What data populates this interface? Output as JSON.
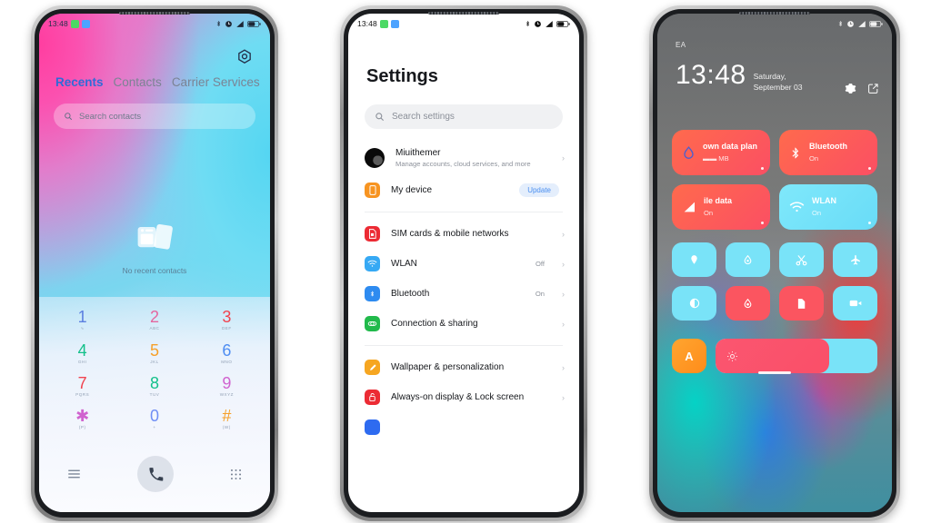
{
  "phone1": {
    "name": "dialer-screen",
    "statusbar": {
      "time": "13:48",
      "badges": [
        "green-call-badge",
        "blue-app-badge"
      ],
      "icons": [
        "bluetooth-icon",
        "alarm-icon",
        "signal-icon",
        "battery-icon"
      ]
    },
    "gear_icon": "gear-icon",
    "tabs": [
      {
        "label": "Recents",
        "active": true
      },
      {
        "label": "Contacts",
        "active": false
      },
      {
        "label": "Carrier Services",
        "active": false
      }
    ],
    "search": {
      "placeholder": "Search contacts",
      "icon": "search-icon"
    },
    "empty_state": {
      "icon": "no-contacts-icon",
      "text": "No recent contacts"
    },
    "keypad": [
      {
        "num": "1",
        "sub": "∿"
      },
      {
        "num": "2",
        "sub": "ABC"
      },
      {
        "num": "3",
        "sub": "DEF"
      },
      {
        "num": "4",
        "sub": "GHI"
      },
      {
        "num": "5",
        "sub": "JKL"
      },
      {
        "num": "6",
        "sub": "MNO"
      },
      {
        "num": "7",
        "sub": "PQRS"
      },
      {
        "num": "8",
        "sub": "TUV"
      },
      {
        "num": "9",
        "sub": "WXYZ"
      },
      {
        "num": "✱",
        "sub": "(P)"
      },
      {
        "num": "0",
        "sub": "+"
      },
      {
        "num": "#",
        "sub": "(W)"
      }
    ],
    "keypad_colors": [
      "#5b7fe0",
      "#e4679f",
      "#f0434f",
      "#13c08a",
      "#f6a02a",
      "#4e8df2",
      "#f0434f",
      "#13c08a",
      "#d063cf",
      "#d063cf",
      "#6f8ef5",
      "#f6a02a"
    ],
    "bottom": {
      "menu_icon": "menu-icon",
      "call_icon": "call-icon",
      "keypad_icon": "keypad-icon"
    }
  },
  "phone2": {
    "name": "settings-screen",
    "statusbar": {
      "time": "13:48",
      "badges": [
        "green-call-badge",
        "blue-app-badge"
      ],
      "icons": [
        "bluetooth-icon",
        "alarm-icon",
        "signal-icon",
        "battery-icon"
      ]
    },
    "title": "Settings",
    "search": {
      "placeholder": "Search settings",
      "icon": "search-icon"
    },
    "account": {
      "name": "Miuithemer",
      "subtitle": "Manage accounts, cloud services, and more",
      "avatar": "avatar"
    },
    "device": {
      "label": "My device",
      "badge": "Update",
      "icon": "phone-icon",
      "color": "#f79421"
    },
    "items": [
      {
        "label": "SIM cards & mobile networks",
        "value": "",
        "icon": "sim-icon",
        "color": "#ec2b34"
      },
      {
        "label": "WLAN",
        "value": "Off",
        "icon": "wifi-icon",
        "color": "#36a9f4"
      },
      {
        "label": "Bluetooth",
        "value": "On",
        "icon": "bluetooth-icon",
        "color": "#2e8bf0"
      },
      {
        "label": "Connection & sharing",
        "value": "",
        "icon": "share-icon",
        "color": "#21ba4b"
      },
      {
        "label": "Wallpaper & personalization",
        "value": "",
        "icon": "brush-icon",
        "color": "#f6a621"
      },
      {
        "label": "Always-on display & Lock screen",
        "value": "",
        "icon": "lock-icon",
        "color": "#ec2b34"
      }
    ],
    "chevron": "›"
  },
  "phone3": {
    "name": "control-center-screen",
    "statusbar": {
      "icons": [
        "bluetooth-icon",
        "alarm-icon",
        "signal-icon",
        "battery-icon"
      ]
    },
    "carrier": "EA",
    "clock": "13:48",
    "date": "Saturday, September 03",
    "actions": [
      "gear-icon",
      "edit-icon"
    ],
    "big_tiles": [
      {
        "title": "own data plan",
        "subtitle": "▬▬ MB",
        "style": "red",
        "icon": "data-drop-icon"
      },
      {
        "title": "Bluetooth",
        "subtitle": "On",
        "style": "red",
        "icon": "bluetooth-icon"
      },
      {
        "title": "ile data",
        "subtitle": "On",
        "style": "red",
        "icon": "signal-icon"
      },
      {
        "title": "WLAN",
        "subtitle": "On",
        "style": "cyan",
        "icon": "wifi-icon"
      }
    ],
    "small_tiles": [
      {
        "icon": "location-icon",
        "style": "cyan"
      },
      {
        "icon": "drop-icon",
        "style": "cyan"
      },
      {
        "icon": "scissors-icon",
        "style": "cyan"
      },
      {
        "icon": "airplane-icon",
        "style": "cyan"
      },
      {
        "icon": "dark-mode-icon",
        "style": "cyan"
      },
      {
        "icon": "flashlight-icon",
        "style": "red"
      },
      {
        "icon": "screenshot-icon",
        "style": "red"
      },
      {
        "icon": "screen-record-icon",
        "style": "cyan"
      }
    ],
    "auto_brightness": {
      "label": "A",
      "icon": "auto-brightness-icon"
    },
    "brightness": {
      "icon": "brightness-icon",
      "percent": 70
    },
    "home_indicator": "home-indicator"
  }
}
